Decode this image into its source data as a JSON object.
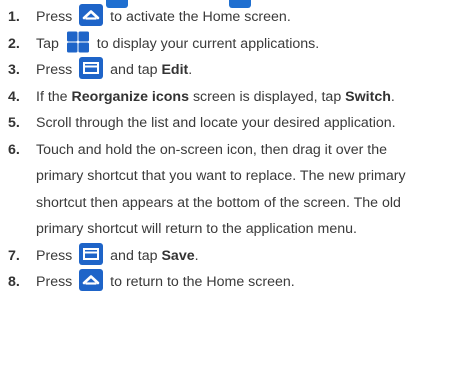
{
  "colors": {
    "icon_blue": "#1e64c8",
    "text": "#3a3a3a"
  },
  "steps": [
    {
      "num": "1.",
      "a": "Press",
      "icon": "home-icon",
      "b": "to activate the Home screen."
    },
    {
      "num": "2.",
      "a": "Tap",
      "icon": "apps-grid-icon",
      "b": "to display your current applications."
    },
    {
      "num": "3.",
      "a": "Press",
      "icon": "menu-icon",
      "b": "and tap",
      "bold": "Edit",
      "c": "."
    },
    {
      "num": "4.",
      "a": "If the",
      "bold": "Reorganize icons",
      "b": "screen is displayed, tap",
      "bold2": "Switch",
      "c": "."
    },
    {
      "num": "5.",
      "text": "Scroll through the list and locate your desired application."
    },
    {
      "num": "6.",
      "lines": [
        "Touch and hold the on-screen icon, then drag it over the",
        "primary shortcut that you want to replace. The new primary",
        "shortcut then appears at the bottom of the screen. The old",
        "primary shortcut will return to the application menu."
      ]
    },
    {
      "num": "7.",
      "a": "Press",
      "icon": "menu-icon",
      "b": "and tap",
      "bold": "Save",
      "c": "."
    },
    {
      "num": "8.",
      "a": "Press",
      "icon": "home-icon",
      "b": "to return to the Home screen."
    }
  ]
}
